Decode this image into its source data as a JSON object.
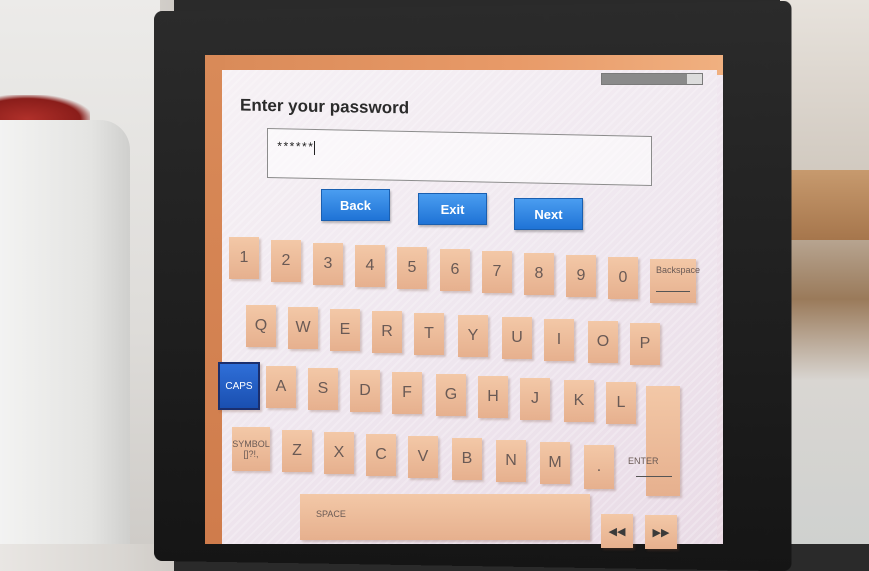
{
  "screen": {
    "title": "Enter your password",
    "password_value": "******",
    "progress": 0.85
  },
  "nav": {
    "back": "Back",
    "exit": "Exit",
    "next": "Next"
  },
  "keyboard": {
    "row_numbers": [
      "1",
      "2",
      "3",
      "4",
      "5",
      "6",
      "7",
      "8",
      "9",
      "0"
    ],
    "backspace": "Backspace",
    "row_qwerty": [
      "Q",
      "W",
      "E",
      "R",
      "T",
      "Y",
      "U",
      "I",
      "O",
      "P"
    ],
    "caps": "CAPS",
    "row_asdf": [
      "A",
      "S",
      "D",
      "F",
      "G",
      "H",
      "J",
      "K",
      "L"
    ],
    "symbol_line1": "SYMBOL",
    "symbol_line2": "[]?!,",
    "row_zxcv": [
      "Z",
      "X",
      "C",
      "V",
      "B",
      "N",
      "M",
      "."
    ],
    "enter": "ENTER",
    "space": "SPACE",
    "rewind": "◀◀",
    "forward": "▶▶"
  },
  "colors": {
    "key": "#eeb99a",
    "nav_button": "#2f86e6",
    "caps_active": "#1f55c0",
    "frame_orange": "#e0935f"
  }
}
